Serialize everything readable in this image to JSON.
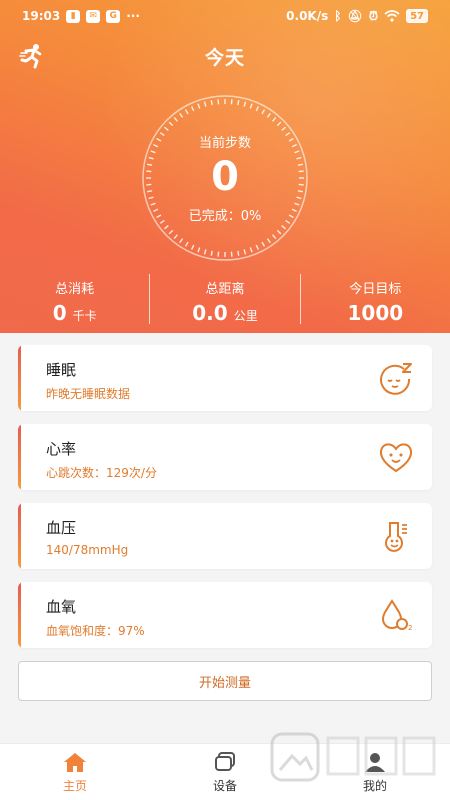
{
  "status_bar": {
    "time": "19:03",
    "net_speed": "0.0K/s",
    "battery": "57",
    "notif_icons": [
      "app-notification-icon",
      "message-icon",
      "g-app-icon"
    ],
    "more": "···"
  },
  "header": {
    "title": "今天"
  },
  "steps": {
    "label": "当前步数",
    "value": "0",
    "completed": "已完成：0%"
  },
  "stats": [
    {
      "label": "总消耗",
      "value": "0",
      "unit": "千卡"
    },
    {
      "label": "总距离",
      "value": "0.0",
      "unit": "公里"
    },
    {
      "label": "今日目标",
      "value": "1000",
      "unit": ""
    }
  ],
  "cards": [
    {
      "title": "睡眠",
      "subtitle": "昨晚无睡眠数据",
      "icon": "sleep-face-icon"
    },
    {
      "title": "心率",
      "subtitle": "心跳次数：129次/分",
      "icon": "heart-face-icon"
    },
    {
      "title": "血压",
      "subtitle": "140/78mmHg",
      "icon": "blood-pressure-icon"
    },
    {
      "title": "血氧",
      "subtitle": "血氧饱和度：97%",
      "icon": "oxygen-drop-icon"
    }
  ],
  "start_button": "开始测量",
  "nav": [
    {
      "label": "主页",
      "icon": "home-icon",
      "active": true
    },
    {
      "label": "设备",
      "icon": "device-icon",
      "active": false
    },
    {
      "label": "我的",
      "icon": "profile-icon",
      "active": false
    }
  ],
  "colors": {
    "accent": "#f0823a",
    "header_top": "#f6a13a",
    "header_bottom": "#f06a4b"
  }
}
